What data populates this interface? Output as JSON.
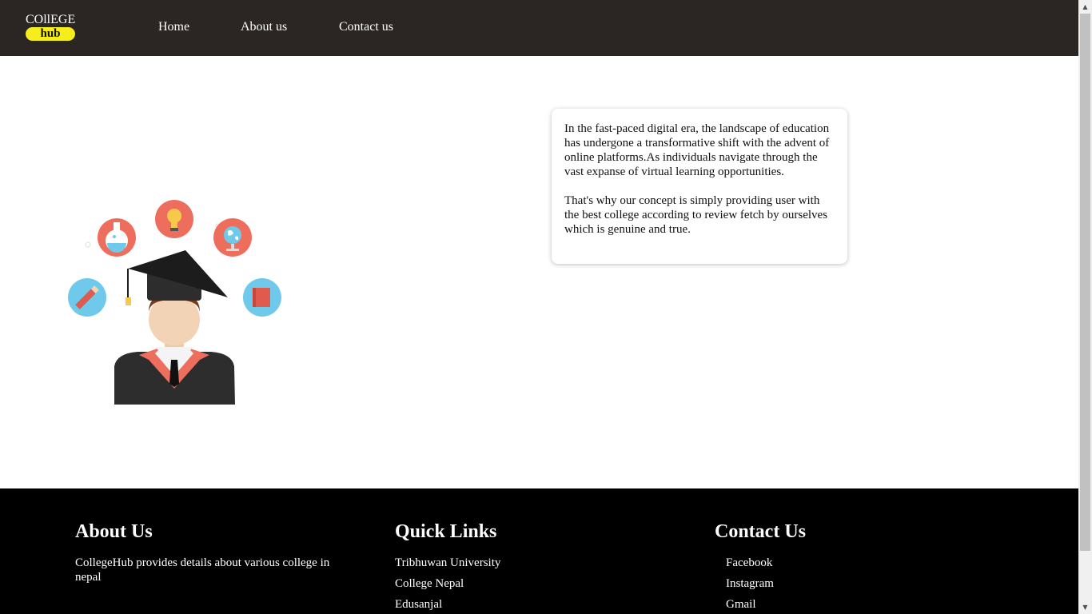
{
  "navbar": {
    "logo_top": "COllEGE",
    "logo_bottom": "hub",
    "links": [
      "Home",
      "About us",
      "Contact us"
    ]
  },
  "illustration": {
    "icons": [
      "flask-icon",
      "lightbulb-icon",
      "globe-icon",
      "pencil-icon",
      "book-icon",
      "graduate-avatar"
    ]
  },
  "info": {
    "paragraph1": "In the fast-paced digital era, the landscape of education has undergone a transformative shift with the advent of online platforms.As individuals navigate through the vast expanse of virtual learning opportunities.",
    "paragraph2": "That's why our concept is simply providing user with the best college according to review fetch by ourselves which is genuine and true."
  },
  "footer": {
    "about": {
      "title": "About Us",
      "text": "CollegeHub provides details about various college in nepal"
    },
    "quick_links": {
      "title": "Quick Links",
      "items": [
        "Tribhuwan University",
        "College Nepal",
        "Edusanjal"
      ]
    },
    "contact": {
      "title": "Contact Us",
      "items": [
        "Facebook",
        "Instagram",
        "Gmail"
      ]
    }
  },
  "colors": {
    "navbar_bg": "#2b2624",
    "logo_accent": "#f5ee1b",
    "footer_bg": "#000000",
    "icon_red": "#ee6e5e",
    "icon_blue": "#6ec9ea"
  }
}
